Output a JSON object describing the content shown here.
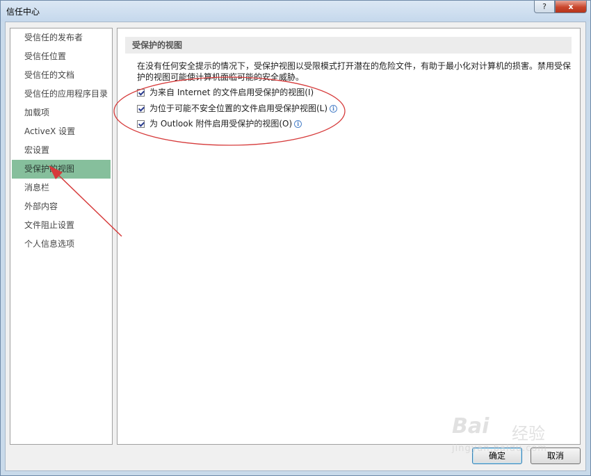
{
  "window": {
    "title": "信任中心",
    "help": "?",
    "close": "x"
  },
  "sidebar": {
    "items": [
      {
        "label": "受信任的发布者"
      },
      {
        "label": "受信任位置"
      },
      {
        "label": "受信任的文档"
      },
      {
        "label": "受信任的应用程序目录"
      },
      {
        "label": "加载项"
      },
      {
        "label": "ActiveX 设置"
      },
      {
        "label": "宏设置"
      },
      {
        "label": "受保护的视图",
        "selected": true
      },
      {
        "label": "消息栏"
      },
      {
        "label": "外部内容"
      },
      {
        "label": "文件阻止设置"
      },
      {
        "label": "个人信息选项"
      }
    ]
  },
  "main": {
    "section_title": "受保护的视图",
    "description": "在没有任何安全提示的情况下，受保护视图以受限模式打开潜在的危险文件，有助于最小化对计算机的损害。禁用受保护的视图可能使计算机面临可能的安全威胁。",
    "options": [
      {
        "label": "为来自 Internet 的文件启用受保护的视图(I)",
        "checked": true,
        "info": false
      },
      {
        "label": "为位于可能不安全位置的文件启用受保护视图(L)",
        "checked": true,
        "info": true
      },
      {
        "label": "为 Outlook 附件启用受保护的视图(O)",
        "checked": true,
        "info": true
      }
    ]
  },
  "footer": {
    "ok_label": "确定",
    "cancel_label": "取消"
  },
  "watermark": {
    "logo": "Bai",
    "text": "经验",
    "url": "jingyan.baidu.com"
  },
  "colors": {
    "selected": "#86bf9c",
    "annotation": "#d63a3a",
    "titlebar": "#c5d8ec"
  }
}
